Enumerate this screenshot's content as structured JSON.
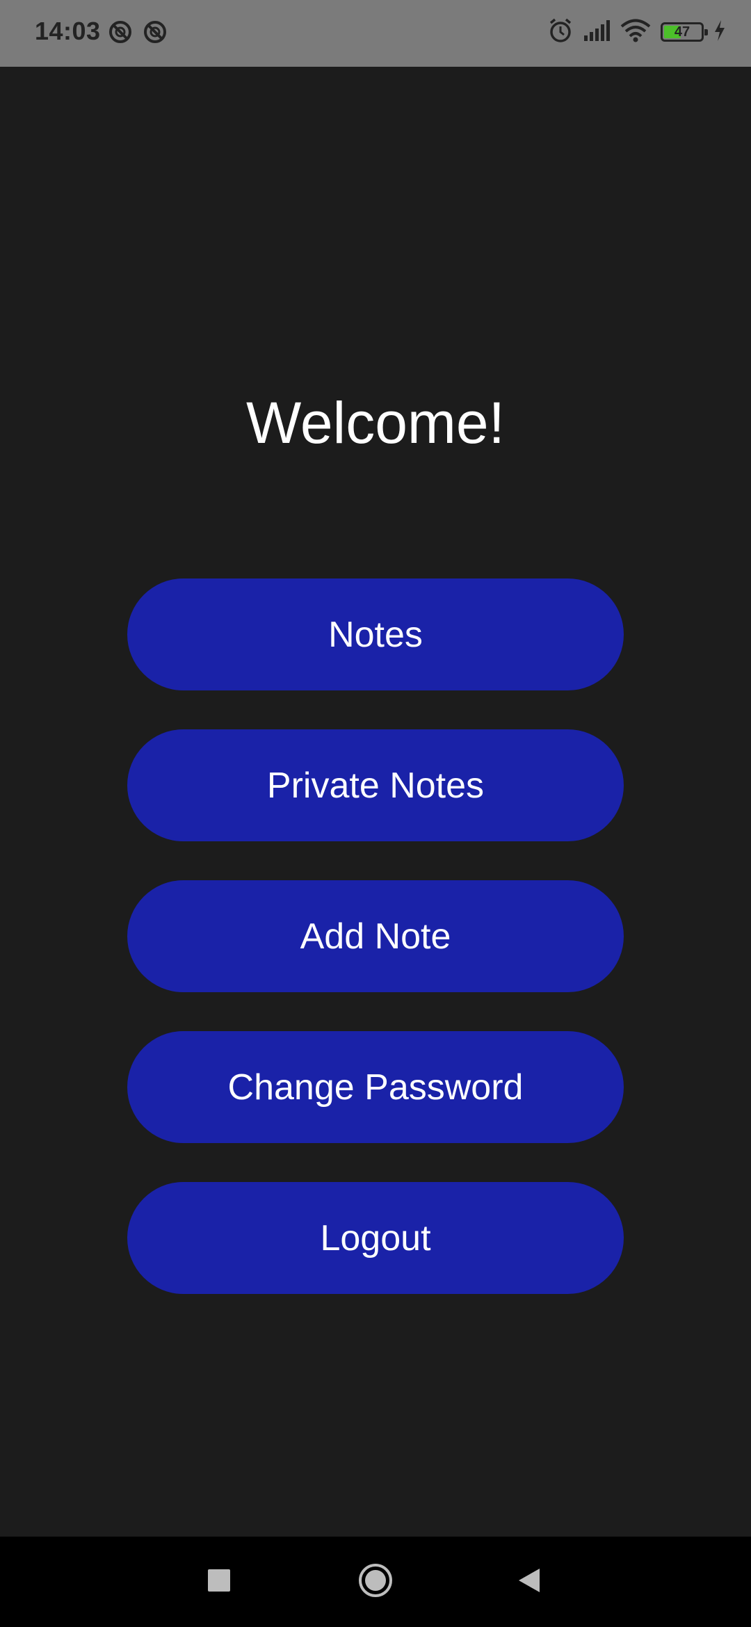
{
  "status_bar": {
    "time": "14:03",
    "left_icons": [
      "dnd-icon",
      "dnd-icon"
    ],
    "right_icons": [
      "alarm-icon",
      "signal-icon",
      "wifi-icon",
      "battery-icon",
      "charging-icon"
    ],
    "battery_level": "47",
    "battery_fraction": 0.47
  },
  "main": {
    "title": "Welcome!",
    "buttons": [
      {
        "label": "Notes"
      },
      {
        "label": "Private Notes"
      },
      {
        "label": "Add Note"
      },
      {
        "label": "Change Password"
      },
      {
        "label": "Logout"
      }
    ]
  },
  "nav_bar": {
    "icons": [
      "recents-icon",
      "home-icon",
      "back-icon"
    ]
  },
  "colors": {
    "background": "#1c1c1c",
    "button": "#1a22a8",
    "text": "#ffffff",
    "status_bar": "#7b7b7b",
    "battery_fill": "#4cc02a"
  }
}
